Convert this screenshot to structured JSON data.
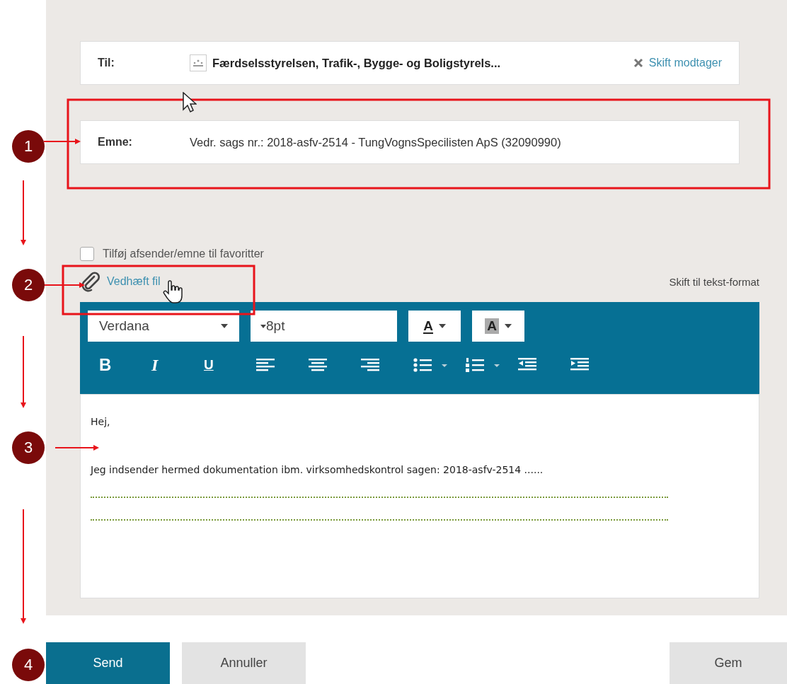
{
  "recipient": {
    "label": "Til:",
    "name": "Færdselsstyrelsen, Trafik-, Bygge- og Boligstyrels...",
    "change": "Skift modtager"
  },
  "subject": {
    "label": "Emne:",
    "value": "Vedr. sags nr.: 2018-asfv-2514 - TungVognsSpecilisten ApS (32090990)"
  },
  "favorite": {
    "label": "Tilføj afsender/emne til favoritter",
    "checked": false
  },
  "attach": "Vedhæft fil",
  "format_switch": "Skift til tekst-format",
  "toolbar": {
    "font": "Verdana",
    "size": "8pt",
    "color_buttons": [
      {
        "kind": "text-color",
        "glyph": "A"
      },
      {
        "kind": "highlight",
        "glyph": "A"
      }
    ],
    "tools": [
      {
        "kind": "bold",
        "glyph": "B"
      },
      {
        "kind": "italic",
        "glyph": "I"
      },
      {
        "kind": "underline",
        "glyph": "U"
      },
      {
        "kind": "align-left"
      },
      {
        "kind": "align-center"
      },
      {
        "kind": "align-right"
      },
      {
        "kind": "bullet-list"
      },
      {
        "kind": "numbered-list"
      },
      {
        "kind": "outdent"
      },
      {
        "kind": "indent"
      }
    ]
  },
  "body": {
    "greeting": "Hej,",
    "paragraph": "Jeg indsender hermed dokumentation ibm. virksomhedskontrol sagen: 2018-asfv-2514 ......"
  },
  "buttons": [
    {
      "label": "Send",
      "kind": "primary"
    },
    {
      "label": "Annuller",
      "kind": "secondary"
    },
    {
      "label": "Gem",
      "kind": "secondary"
    }
  ],
  "annotations": [
    {
      "number": "1"
    },
    {
      "number": "2"
    },
    {
      "number": "3"
    },
    {
      "number": "4"
    }
  ]
}
